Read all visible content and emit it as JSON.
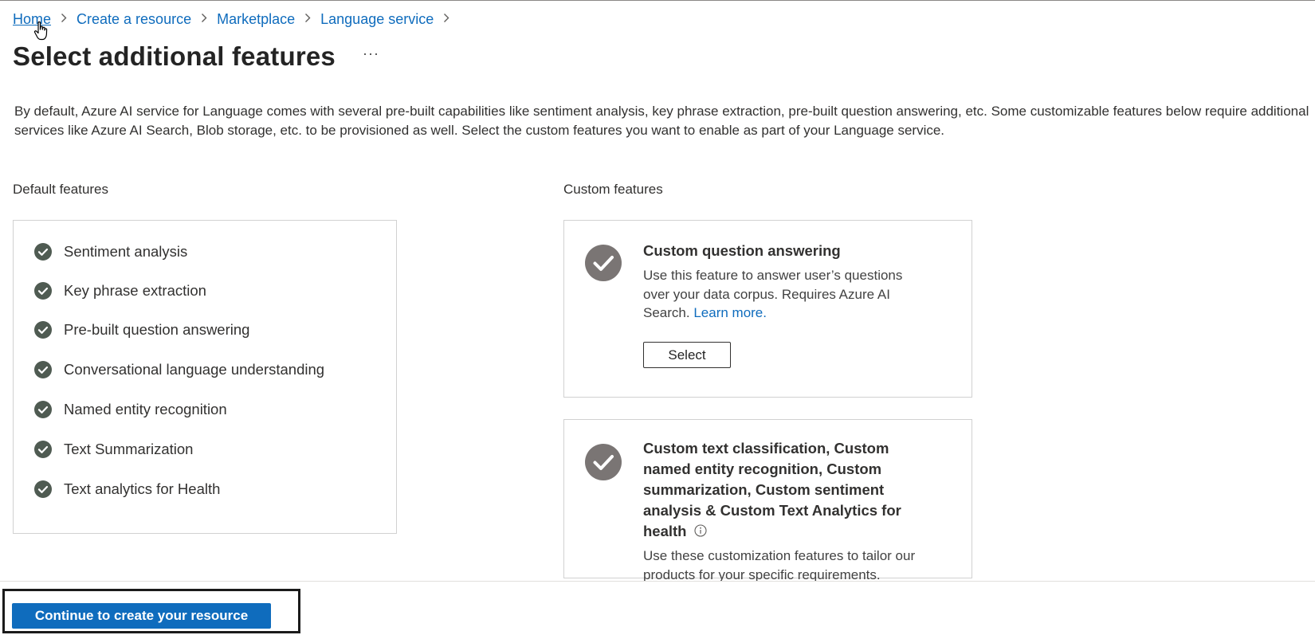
{
  "breadcrumb": {
    "items": [
      "Home",
      "Create a resource",
      "Marketplace",
      "Language service"
    ]
  },
  "title": "Select additional features",
  "more_label": "···",
  "intro": "By default, Azure AI service for Language comes with several pre-built capabilities like sentiment analysis, key phrase extraction, pre-built question answering, etc. Some customizable features below require additional services like Azure AI Search, Blob storage, etc. to be provisioned as well. Select the custom features you want to enable as part of your Language service.",
  "default_features": {
    "label": "Default features",
    "items": [
      "Sentiment analysis",
      "Key phrase extraction",
      "Pre-built question answering",
      "Conversational language understanding",
      "Named entity recognition",
      "Text Summarization",
      "Text analytics for Health"
    ]
  },
  "custom_features": {
    "label": "Custom features",
    "cards": [
      {
        "title": "Custom question answering",
        "description": "Use this feature to answer user’s questions over your data corpus. Requires Azure AI Search.",
        "link": "Learn more.",
        "button": "Select"
      },
      {
        "title": "Custom text classification, Custom named entity recognition, Custom summarization, Custom sentiment analysis & Custom Text Analytics for health",
        "description": "Use these customization features to tailor our products for your specific requirements."
      }
    ]
  },
  "footer": {
    "primary_button": "Continue to create your resource"
  },
  "icons": {
    "check_small": "check-circle-icon",
    "check_large": "check-circle-icon",
    "info": "info-icon",
    "chevron": "chevron-right-icon",
    "cursor": "hand-pointer-icon"
  },
  "colors": {
    "link": "#0f6cbd",
    "primary_button": "#0f6cbd",
    "check_small": "#4f5b52",
    "check_large": "#7a7574"
  }
}
